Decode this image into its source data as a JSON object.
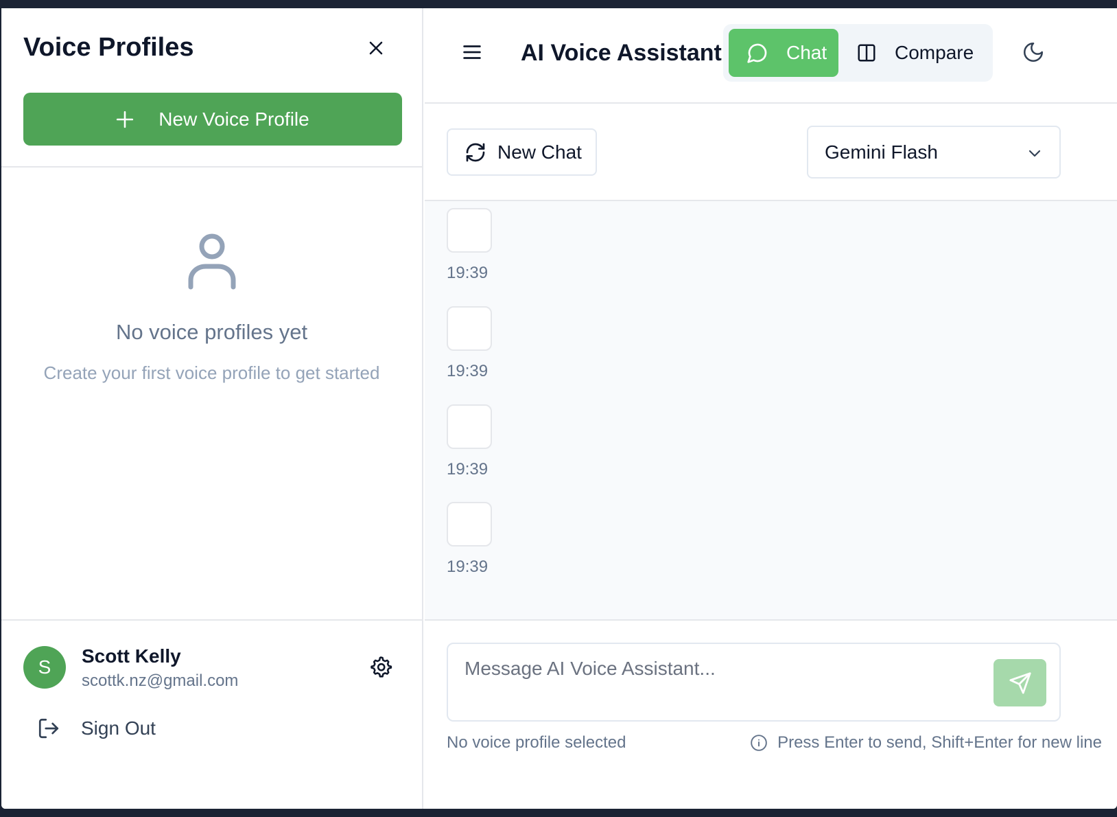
{
  "sidebar": {
    "title": "Voice Profiles",
    "new_profile_label": "New Voice Profile",
    "empty_title": "No voice profiles yet",
    "empty_subtitle": "Create your first voice profile to get started",
    "user": {
      "initial": "S",
      "name": "Scott Kelly",
      "email": "scottk.nz@gmail.com"
    },
    "sign_out_label": "Sign Out"
  },
  "header": {
    "title": "AI Voice Assistant",
    "modes": [
      {
        "label": "Chat",
        "active": true
      },
      {
        "label": "Compare",
        "active": false
      }
    ]
  },
  "toolbar": {
    "new_chat_label": "New Chat",
    "model_selected": "Gemini Flash"
  },
  "messages": [
    {
      "time": "19:39"
    },
    {
      "time": "19:39"
    },
    {
      "time": "19:39"
    },
    {
      "time": "19:39"
    }
  ],
  "composer": {
    "placeholder": "Message AI Voice Assistant...",
    "status_text": "No voice profile selected",
    "hint_text": "Press Enter to send, Shift+Enter for new line"
  },
  "colors": {
    "brand_green": "#4fa456",
    "active_tab_green": "#5dc36a",
    "send_button_disabled": "#a6d9ab"
  }
}
